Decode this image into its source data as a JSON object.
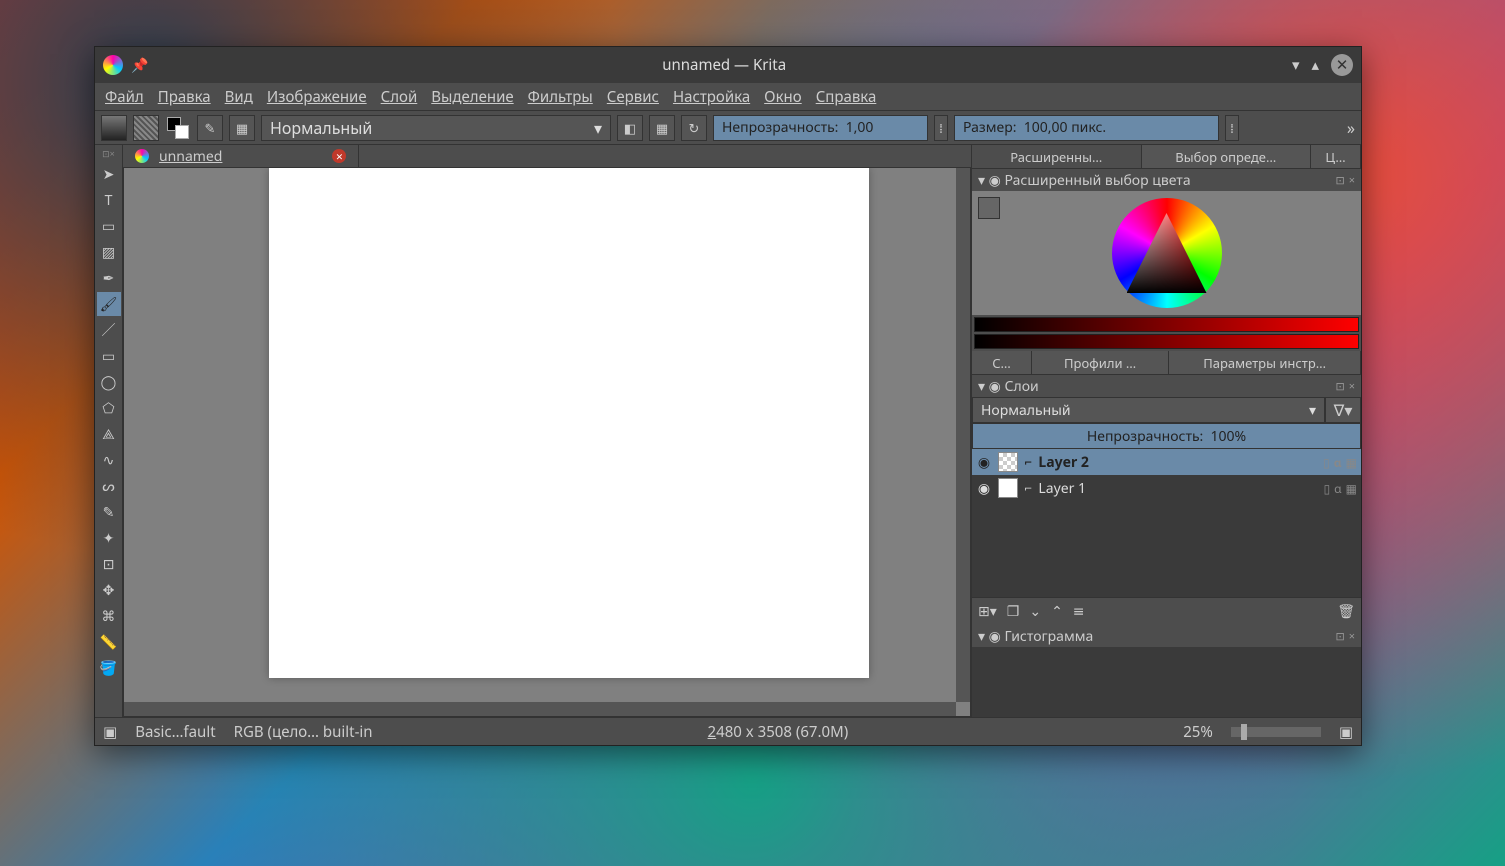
{
  "window": {
    "title": "unnamed  — Krita"
  },
  "menu": {
    "file": "Файл",
    "edit": "Правка",
    "view": "Вид",
    "image": "Изображение",
    "layer": "Слой",
    "select": "Выделение",
    "filters": "Фильтры",
    "tools": "Сервис",
    "settings": "Настройка",
    "window": "Окно",
    "help": "Справка"
  },
  "toolbar": {
    "blend_mode": "Нормальный",
    "opacity_label": "Непрозрачность:",
    "opacity_value": "1,00",
    "size_label": "Размер:",
    "size_value": "100,00",
    "size_unit": "пикс."
  },
  "document": {
    "tab_name": "unnamed"
  },
  "dockers": {
    "right_tabs": {
      "t1": "Расширенны…",
      "t2": "Выбор опреде…",
      "t3": "Ц…"
    },
    "color_header": "Расширенный выбор цвета",
    "mid_tabs": {
      "t1": "С…",
      "t2": "Профили …",
      "t3": "Параметры инстр…"
    },
    "layers_header": "Слои",
    "layer_blend": "Нормальный",
    "layer_opacity_label": "Непрозрачность:",
    "layer_opacity_value": "100%",
    "layers": [
      {
        "name": "Layer 2",
        "selected": true,
        "checker": true
      },
      {
        "name": "Layer 1",
        "selected": false,
        "checker": false
      }
    ],
    "histogram_header": "Гистограмма"
  },
  "status": {
    "preset": "Basic…fault",
    "colorspace": "RGB (цело… built-in",
    "dimensions": "2480 x 3508 (67.0M)",
    "zoom": "25%"
  }
}
